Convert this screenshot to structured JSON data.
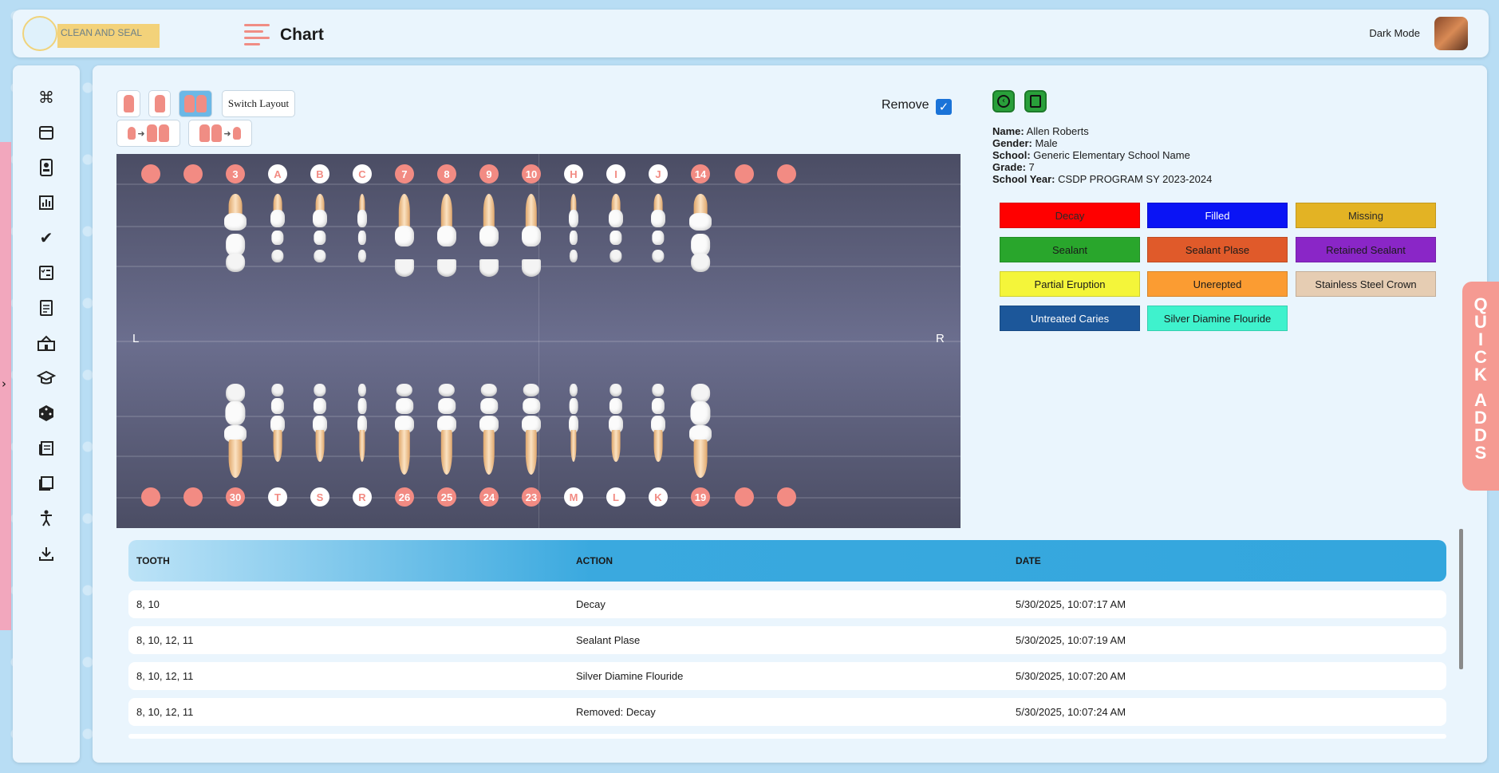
{
  "header": {
    "logo_text": "CLEAN AND SEAL",
    "page_title": "Chart",
    "dark_mode_label": "Dark Mode"
  },
  "sidebar": {
    "icons": [
      "command-icon",
      "calendar-icon",
      "contacts-icon",
      "bar-chart-icon",
      "double-check-icon",
      "checklist-icon",
      "document-icon",
      "school-icon",
      "graduation-cap-icon",
      "dice-icon",
      "newspaper-icon",
      "book-icon",
      "accessibility-icon",
      "download-icon"
    ]
  },
  "toolbar": {
    "switch_layout_label": "Switch Layout",
    "remove_label": "Remove",
    "remove_checked": true
  },
  "chart": {
    "left_label": "L",
    "right_label": "R",
    "top_circles": [
      "",
      "",
      "3",
      "A",
      "B",
      "C",
      "7",
      "8",
      "9",
      "10",
      "H",
      "I",
      "J",
      "14",
      "",
      ""
    ],
    "bottom_circles": [
      "",
      "",
      "30",
      "T",
      "S",
      "R",
      "26",
      "25",
      "24",
      "23",
      "M",
      "L",
      "K",
      "19",
      "",
      ""
    ]
  },
  "patient": {
    "name_label": "Name:",
    "name": "Allen Roberts",
    "gender_label": "Gender:",
    "gender": "Male",
    "school_label": "School:",
    "school": "Generic Elementary School Name",
    "grade_label": "Grade:",
    "grade": "7",
    "year_label": "School Year:",
    "year": "CSDP PROGRAM SY 2023-2024"
  },
  "legend": [
    {
      "label": "Decay",
      "color": "#ff0000",
      "text": "#2a2a2a"
    },
    {
      "label": "Filled",
      "color": "#0a14f5",
      "text": "#ffffff"
    },
    {
      "label": "Missing",
      "color": "#e3b324",
      "text": "#2a2a2a"
    },
    {
      "label": "Sealant",
      "color": "#29a62c",
      "text": "#1a1a1a"
    },
    {
      "label": "Sealant Plase",
      "color": "#e05a2a",
      "text": "#1a1a1a"
    },
    {
      "label": "Retained Sealant",
      "color": "#8a26c7",
      "text": "#1a1a1a"
    },
    {
      "label": "Partial Eruption",
      "color": "#f4f53a",
      "text": "#1a1a1a"
    },
    {
      "label": "Unerepted",
      "color": "#fb9c32",
      "text": "#1a1a1a"
    },
    {
      "label": "Stainless Steel Crown",
      "color": "#e6cdb3",
      "text": "#1a1a1a"
    },
    {
      "label": "Untreated Caries",
      "color": "#1c579a",
      "text": "#ffffff"
    },
    {
      "label": "Silver Diamine Flouride",
      "color": "#3ff2cd",
      "text": "#1a1a1a"
    }
  ],
  "quick_adds": "QUICK ADDS",
  "table": {
    "headers": [
      "TOOTH",
      "ACTION",
      "DATE"
    ],
    "rows": [
      {
        "tooth": "8, 10",
        "action": "Decay",
        "date": "5/30/2025, 10:07:17 AM"
      },
      {
        "tooth": "8, 10, 12, 11",
        "action": "Sealant Plase",
        "date": "5/30/2025, 10:07:19 AM"
      },
      {
        "tooth": "8, 10, 12, 11",
        "action": "Silver Diamine Flouride",
        "date": "5/30/2025, 10:07:20 AM"
      },
      {
        "tooth": "8, 10, 12, 11",
        "action": "Removed: Decay",
        "date": "5/30/2025, 10:07:24 AM"
      }
    ]
  }
}
